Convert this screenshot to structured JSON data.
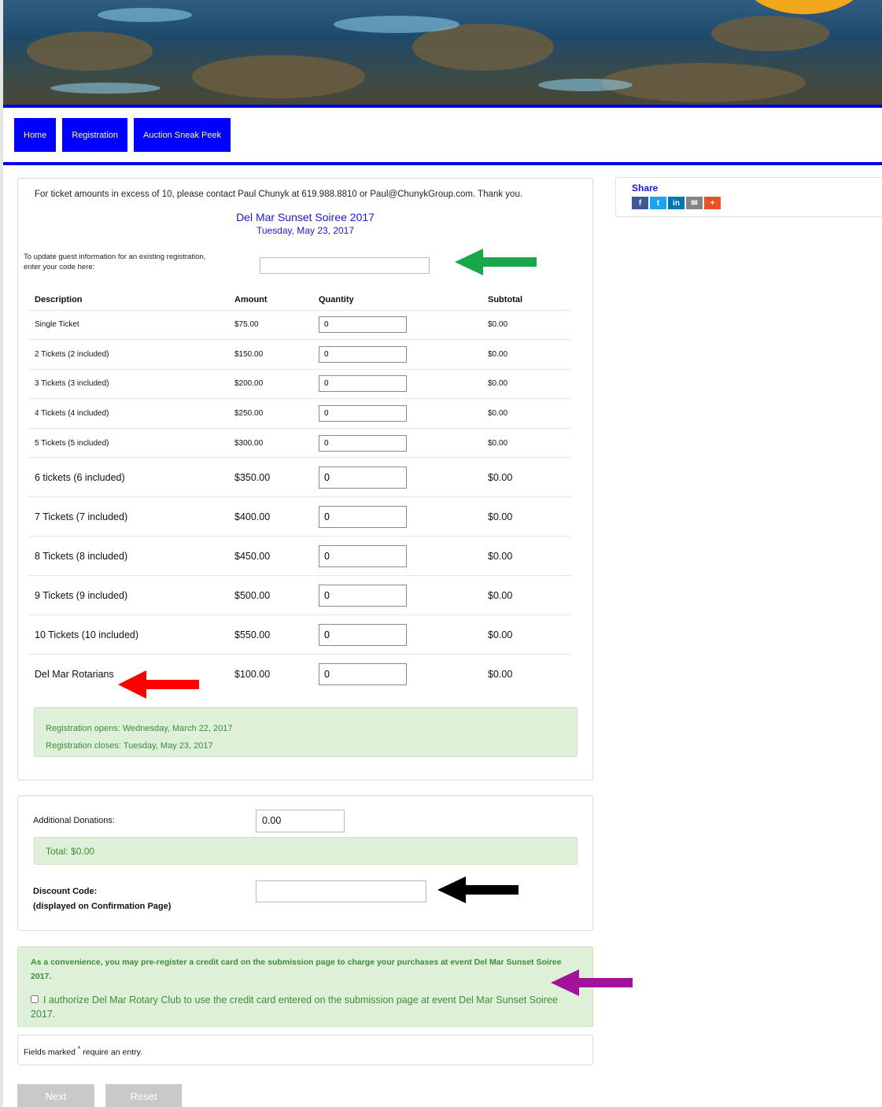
{
  "nav": {
    "items": [
      "Home",
      "Registration",
      "Auction Sneak Peek"
    ]
  },
  "form": {
    "note": "For ticket amounts in excess of 10, please contact Paul Chunyk at 619.988.8810 or Paul@ChunykGroup.com. Thank you.",
    "event_title": "Del Mar Sunset Soiree 2017",
    "event_date": "Tuesday, May 23, 2017",
    "update_label": "To update guest information for an existing registration, enter your code here:",
    "update_value": "",
    "headers": [
      "Description",
      "Amount",
      "Quantity",
      "Subtotal"
    ],
    "rows": [
      {
        "description": "Single Ticket",
        "amount": "$75.00",
        "quantity": "0",
        "subtotal": "$0.00"
      },
      {
        "description": "2 Tickets (2 included)",
        "amount": "$150.00",
        "quantity": "0",
        "subtotal": "$0.00"
      },
      {
        "description": "3 Tickets (3 included)",
        "amount": "$200.00",
        "quantity": "0",
        "subtotal": "$0.00"
      },
      {
        "description": "4 Tickets (4 included)",
        "amount": "$250.00",
        "quantity": "0",
        "subtotal": "$0.00"
      },
      {
        "description": "5 Tickets (5 included)",
        "amount": "$300.00",
        "quantity": "0",
        "subtotal": "$0.00"
      },
      {
        "description": "6 tickets (6 included)",
        "amount": "$350.00",
        "quantity": "0",
        "subtotal": "$0.00"
      },
      {
        "description": "7 Tickets (7 included)",
        "amount": "$400.00",
        "quantity": "0",
        "subtotal": "$0.00"
      },
      {
        "description": "8 Tickets (8 included)",
        "amount": "$450.00",
        "quantity": "0",
        "subtotal": "$0.00"
      },
      {
        "description": "9 Tickets (9 included)",
        "amount": "$500.00",
        "quantity": "0",
        "subtotal": "$0.00"
      },
      {
        "description": "10 Tickets (10 included)",
        "amount": "$550.00",
        "quantity": "0",
        "subtotal": "$0.00"
      },
      {
        "description": "Del Mar Rotarians",
        "amount": "$100.00",
        "quantity": "0",
        "subtotal": "$0.00"
      }
    ],
    "registration_opens": "Registration opens: Wednesday, March 22, 2017",
    "registration_closes": "Registration closes: Tuesday, May 23, 2017",
    "donation_label": "Additional Donations:",
    "donation_value": "0.00",
    "total_label": "Total:",
    "total_value": "$0.00",
    "discount_label": "Discount Code:",
    "discount_sub": "(displayed on Confirmation Page)",
    "discount_value": "",
    "cc_notice": "As a convenience, you may pre-register a credit card on the submission page to charge your purchases at event Del Mar Sunset Soiree 2017.",
    "cc_authorize": "I authorize Del Mar Rotary Club to use the credit card entered on the submission page at event Del Mar Sunset Soiree 2017.",
    "required_prefix": "Fields marked",
    "required_mark": "*",
    "required_suffix": "require an entry.",
    "next_label": "Next",
    "reset_label": "Reset"
  },
  "share": {
    "title": "Share",
    "icons": [
      {
        "name": "facebook-icon",
        "glyph": "f",
        "color": "#3b5998"
      },
      {
        "name": "twitter-icon",
        "glyph": "t",
        "color": "#1da1f2"
      },
      {
        "name": "linkedin-icon",
        "glyph": "in",
        "color": "#0077b5"
      },
      {
        "name": "email-icon",
        "glyph": "✉",
        "color": "#848484"
      },
      {
        "name": "more-icon",
        "glyph": "+",
        "color": "#f04e23"
      }
    ]
  },
  "colors": {
    "nav_bg": "#0000ff",
    "nav_text": "#ffff66",
    "accent_blue": "#1a1ad6",
    "success_bg": "#dff0d8",
    "success_text": "#3c8c3c",
    "arrow_green": "#1aa64a",
    "arrow_red": "#ff0000",
    "arrow_black": "#000000",
    "arrow_purple": "#a0139a"
  }
}
